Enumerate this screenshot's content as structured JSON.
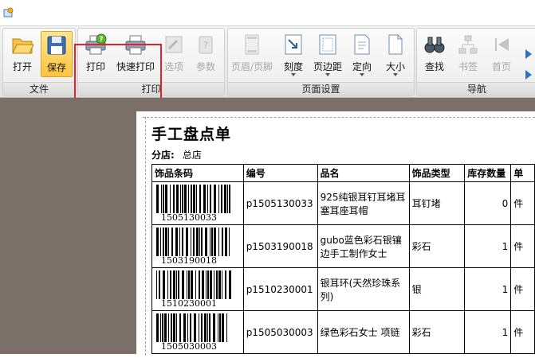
{
  "ribbon": {
    "groups": [
      {
        "id": "file",
        "label": "文件"
      },
      {
        "id": "print",
        "label": "打印"
      },
      {
        "id": "page",
        "label": "页面设置"
      },
      {
        "id": "nav",
        "label": "导航"
      }
    ],
    "buttons": {
      "open": "打开",
      "save": "保存",
      "print": "打印",
      "quick_print": "快速打印",
      "options": "选项",
      "params": "参数",
      "header_footer": "页眉/页脚",
      "scale": "刻度",
      "margins": "页边距",
      "orientation": "定向",
      "size": "大小",
      "find": "查找",
      "bookmark": "书签",
      "first_page": "首页"
    }
  },
  "report": {
    "title": "手工盘点单",
    "store_label": "分店:",
    "store_value": "总店",
    "columns": [
      "饰品条码",
      "编号",
      "品名",
      "饰品类型",
      "库存数量",
      "单"
    ],
    "rows": [
      {
        "barcode": "1505130033",
        "code": "p1505130033",
        "name": "925纯银耳钉耳堵耳塞耳座耳帽",
        "type": "耳钉堵",
        "qty": "0",
        "unit": "件"
      },
      {
        "barcode": "1503190018",
        "code": "p1503190018",
        "name": "gubo蓝色彩石银镶边手工制作女士",
        "type": "彩石",
        "qty": "1",
        "unit": "件"
      },
      {
        "barcode": "1510230001",
        "code": "p1510230001",
        "name": "银耳环(天然珍珠系列)",
        "type": "银",
        "qty": "1",
        "unit": "件"
      },
      {
        "barcode": "1505030003",
        "code": "p1505030003",
        "name": "绿色彩石女士 项链",
        "type": "彩石",
        "qty": "1",
        "unit": "件"
      }
    ]
  }
}
